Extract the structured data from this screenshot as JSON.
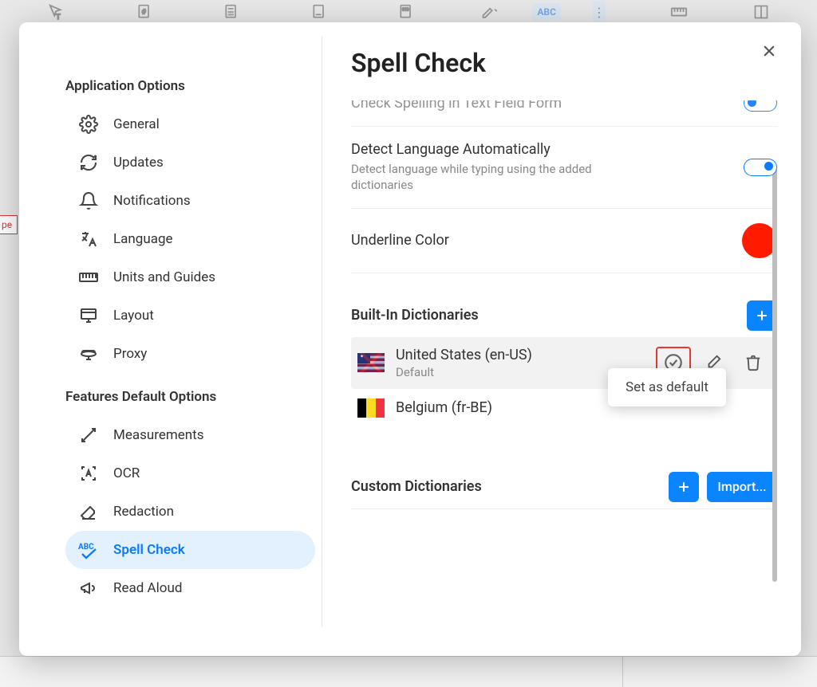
{
  "bg": {
    "abc": "ABC",
    "left_tab": "pe"
  },
  "modal": {
    "title": "Spell Check",
    "group1_title": "Application Options",
    "group2_title": "Features Default Options",
    "sidebar_app": [
      {
        "id": "general",
        "label": "General"
      },
      {
        "id": "updates",
        "label": "Updates"
      },
      {
        "id": "notifications",
        "label": "Notifications"
      },
      {
        "id": "language",
        "label": "Language"
      },
      {
        "id": "units",
        "label": "Units and Guides"
      },
      {
        "id": "layout",
        "label": "Layout"
      },
      {
        "id": "proxy",
        "label": "Proxy"
      }
    ],
    "sidebar_feat": [
      {
        "id": "measurements",
        "label": "Measurements"
      },
      {
        "id": "ocr",
        "label": "OCR"
      },
      {
        "id": "redaction",
        "label": "Redaction"
      },
      {
        "id": "spellcheck",
        "label": "Spell Check"
      },
      {
        "id": "readaloud",
        "label": "Read Aloud"
      }
    ]
  },
  "content": {
    "row1": {
      "label": "Check Spelling in Text Field Form",
      "toggle": "off"
    },
    "row2": {
      "label": "Detect Language Automatically",
      "sub": "Detect language while typing using the added dictionaries",
      "toggle": "on"
    },
    "row3": {
      "label": "Underline Color",
      "color": "#ff1a00"
    },
    "builtin_title": "Built-In Dictionaries",
    "dicts": [
      {
        "name": "United States (en-US)",
        "sub": "Default",
        "flag": "us"
      },
      {
        "name": "Belgium (fr-BE)",
        "flag": "be"
      }
    ],
    "custom_title": "Custom Dictionaries",
    "import_label": "Import...",
    "tooltip": "Set as default"
  }
}
